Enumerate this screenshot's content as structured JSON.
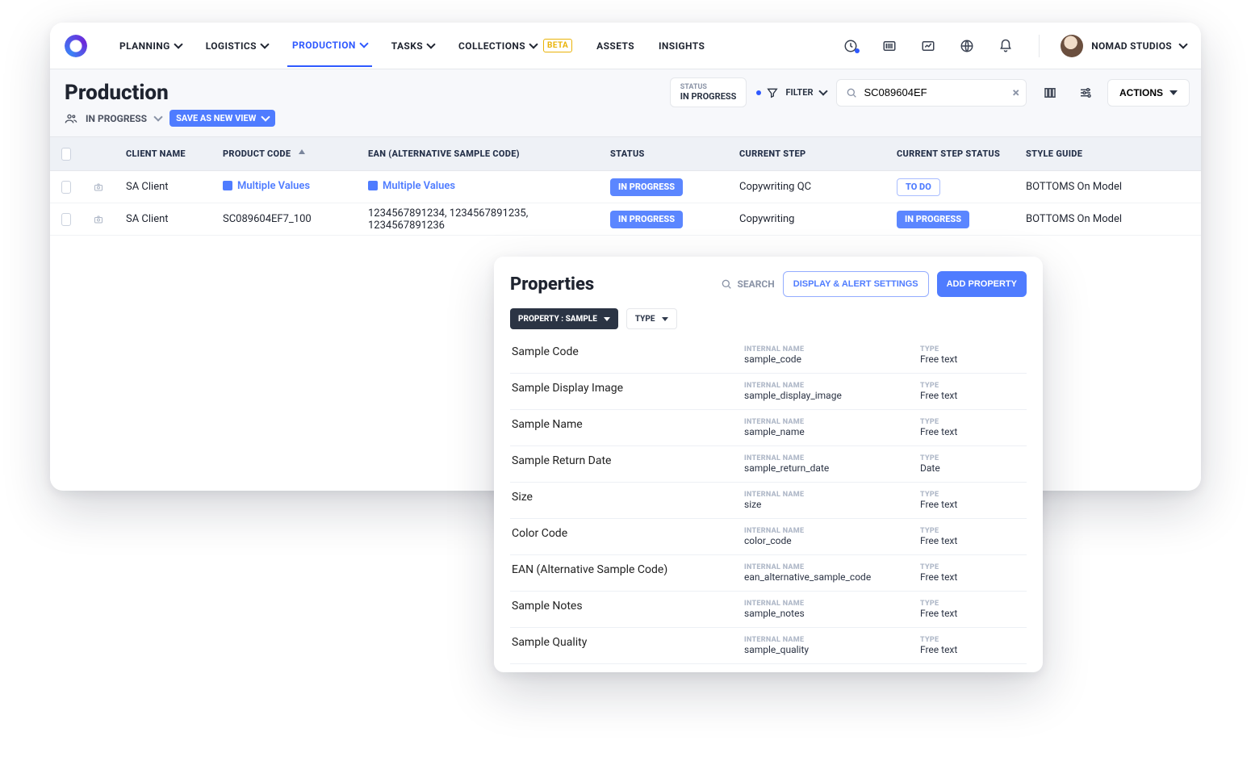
{
  "nav": {
    "items": [
      {
        "label": "PLANNING",
        "active": false,
        "caret": true
      },
      {
        "label": "LOGISTICS",
        "active": false,
        "caret": true
      },
      {
        "label": "PRODUCTION",
        "active": true,
        "caret": true
      },
      {
        "label": "TASKS",
        "active": false,
        "caret": true
      },
      {
        "label": "COLLECTIONS",
        "active": false,
        "caret": true,
        "badge": "BETA"
      },
      {
        "label": "ASSETS",
        "active": false,
        "caret": false
      },
      {
        "label": "INSIGHTS",
        "active": false,
        "caret": false
      }
    ]
  },
  "account": {
    "name": "NOMAD STUDIOS"
  },
  "page": {
    "title": "Production",
    "view_label": "IN PROGRESS",
    "save_view_btn": "SAVE AS NEW VIEW",
    "status_chip_label": "STATUS",
    "status_chip_value": "IN PROGRESS",
    "filter_label": "FILTER",
    "search_value": "SC089604EF",
    "actions_label": "ACTIONS"
  },
  "table": {
    "headers": {
      "client": "CLIENT NAME",
      "product": "PRODUCT CODE",
      "ean": "EAN (ALTERNATIVE SAMPLE CODE)",
      "status": "STATUS",
      "curstep": "CURRENT STEP",
      "curstat": "CURRENT STEP STATUS",
      "style": "STYLE GUIDE"
    },
    "rows": [
      {
        "client": "SA Client",
        "product": "Multiple Values",
        "product_link": true,
        "ean": "Multiple Values",
        "ean_link": true,
        "status": "IN PROGRESS",
        "curstep": "Copywriting QC",
        "curstat": "TO DO",
        "curstat_style": "outline",
        "style": "BOTTOMS On Model"
      },
      {
        "client": "SA Client",
        "product": "SC089604EF7_100",
        "product_link": false,
        "ean": "1234567891234, 1234567891235, 1234567891236",
        "ean_link": false,
        "status": "IN PROGRESS",
        "curstep": "Copywriting",
        "curstat": "IN PROGRESS",
        "curstat_style": "solid",
        "style": "BOTTOMS On Model"
      }
    ]
  },
  "panel": {
    "title": "Properties",
    "search_label": "SEARCH",
    "btn_display": "DISPLAY & ALERT SETTINGS",
    "btn_add": "ADD PROPERTY",
    "chip_property": "PROPERTY : SAMPLE",
    "chip_type": "TYPE",
    "col_internal": "INTERNAL NAME",
    "col_type": "TYPE",
    "rows": [
      {
        "name": "Sample Code",
        "internal": "sample_code",
        "type": "Free text"
      },
      {
        "name": "Sample Display Image",
        "internal": "sample_display_image",
        "type": "Free text"
      },
      {
        "name": "Sample Name",
        "internal": "sample_name",
        "type": "Free text"
      },
      {
        "name": "Sample Return Date",
        "internal": "sample_return_date",
        "type": "Date"
      },
      {
        "name": "Size",
        "internal": "size",
        "type": "Free text"
      },
      {
        "name": "Color Code",
        "internal": "color_code",
        "type": "Free text"
      },
      {
        "name": "EAN (Alternative Sample Code)",
        "internal": "ean_alternative_sample_code",
        "type": "Free text"
      },
      {
        "name": "Sample Notes",
        "internal": "sample_notes",
        "type": "Free text"
      },
      {
        "name": "Sample Quality",
        "internal": "sample_quality",
        "type": "Free text"
      }
    ]
  }
}
